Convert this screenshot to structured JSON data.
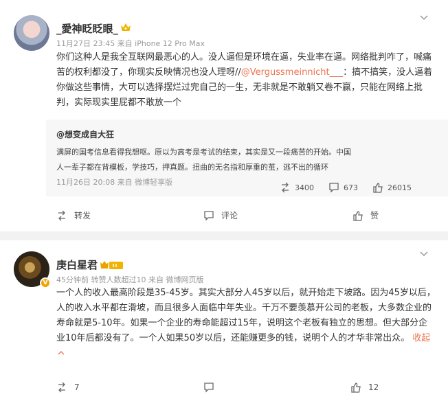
{
  "posts": [
    {
      "author": "_愛神眨眨眼_",
      "meta": "11月27日 23:45  来自 iPhone 12 Pro Max",
      "body_before": "你们这种人是我全互联网最恶心的人。没人逼但是环境在逼，失业率在逼。网络批判咋了，喊痛苦的权利都没了，你现实反映情况也没人理呀//",
      "mention": "@Vergussmeinnicht___",
      "body_after": "：搞不搞笑，没人逼着你做这些事情，大可以选择摆烂过完自己的一生，无非就是不敢躺又卷不赢，只能在网络上批判，实际现实里屁都不敢放一个",
      "repost": {
        "author": "@想变成自大狂",
        "text": "满屏的国考信息看得我想呕。原以为高考是考试的结束，其实是又一段痛苦的开始。中国人一辈子都在背模板，学技巧，押真题。扭曲的无名指和厚重的茧，逃不出的循环",
        "meta": "11月26日 20:08  来自 微博轻享版",
        "reposts": "3400",
        "comments": "673",
        "likes": "26015"
      },
      "actions": {
        "repost": "转发",
        "comment": "评论",
        "like": "赞"
      }
    },
    {
      "author": "庚白星君",
      "meta": "45分钟前  转赞人数超过10  来自 微博网页版",
      "body": "一个人的收入最高阶段是35-45岁。其实大部分人45岁以后，就开始走下坡路。因为45岁以后，人的收入水平都在滑坡，而且很多人面临中年失业。千万不要羡慕开公司的老板，大多数企业的寿命就是5-10年。如果一个企业的寿命能超过15年，说明这个老板有独立的思想。但大部分企业10年后都没有了。一个人如果50岁以后，还能赚更多的钱，说明个人的才华非常出众。",
      "collapse": "收起",
      "reposts": "7",
      "comments": "",
      "likes": "12"
    }
  ],
  "colors": {
    "accent": "#eb7350",
    "meta": "#999999"
  }
}
